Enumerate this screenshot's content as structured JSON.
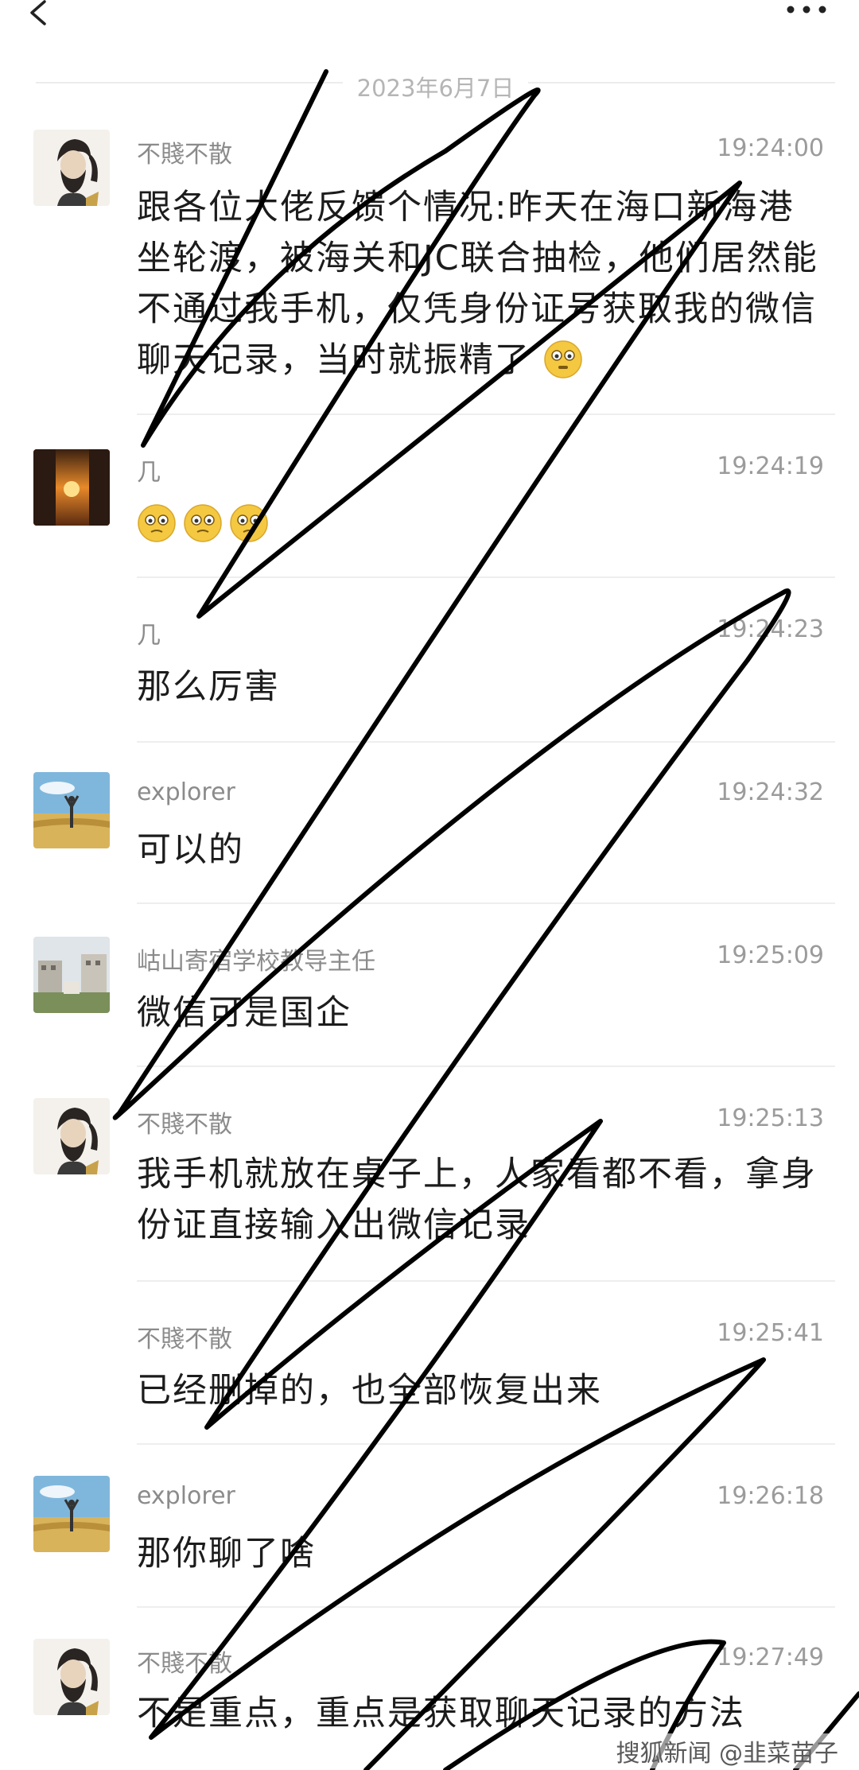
{
  "header": {
    "back_icon": "back-chevron-icon",
    "more_icon": "more-dots-icon"
  },
  "date_separator": "2023年6月7日",
  "messages": [
    {
      "sender": "不賤不散",
      "time": "19:24:00",
      "text": "跟各位大佬反馈个情况:昨天在海口新海港坐轮渡，被海关和JC联合抽检，他们居然能不通过我手机，仅凭身份证号获取我的微信聊天记录，当时就振精了"
    },
    {
      "sender": "几",
      "time": "19:24:19",
      "text": ""
    },
    {
      "sender": "几",
      "time": "19:24:23",
      "text": "那么厉害"
    },
    {
      "sender": "explorer",
      "time": "19:24:32",
      "text": "可以的"
    },
    {
      "sender": "岵山寄宿学校教导主任",
      "time": "19:25:09",
      "text": "微信可是国企"
    },
    {
      "sender": "不賤不散",
      "time": "19:25:13",
      "text": "我手机就放在桌子上，人家看都不看，拿身份证直接输入出微信记录"
    },
    {
      "sender": "不賤不散",
      "time": "19:25:41",
      "text": "已经删掉的，也全部恢复出来"
    },
    {
      "sender": "explorer",
      "time": "19:26:18",
      "text": "那你聊了啥"
    },
    {
      "sender": "不賤不散",
      "time": "19:27:49",
      "text": "不是重点，重点是获取聊天记录的方法"
    }
  ],
  "watermark": "搜狐新闻 @韭菜苗子",
  "colors": {
    "scribble": "#000000",
    "emoji_face": "#f5c842"
  }
}
